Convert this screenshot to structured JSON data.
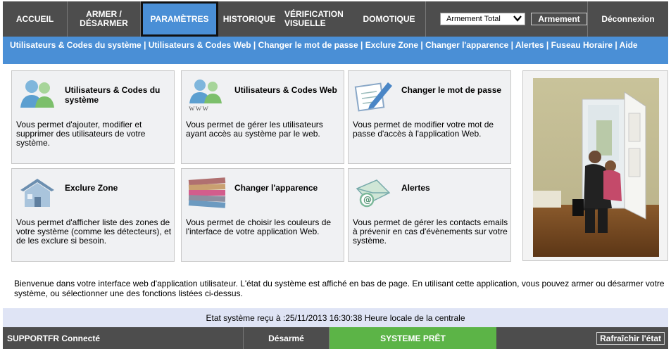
{
  "nav": {
    "accueil": "ACCUEIL",
    "armer_line1": "ARMER /",
    "armer_line2": "DÉSARMER",
    "parametres": "PARAMÈTRES",
    "historique": "HISTORIQUE",
    "verif_line1": "VÉRIFICATION",
    "verif_line2": "VISUELLE",
    "domotique": "DOMOTIQUE",
    "arm_select_value": "Armement Total",
    "arm_button": "Armement",
    "deconnexion": "Déconnexion"
  },
  "subnav": {
    "links": [
      "Utilisateurs & Codes du système",
      "Utilisateurs & Codes Web",
      "Changer le mot de passe",
      "Exclure Zone",
      "Changer l'apparence",
      "Alertes",
      "Fuseau Horaire",
      "Aide"
    ]
  },
  "tiles": [
    {
      "title": "Utilisateurs & Codes du système",
      "desc": "Vous permet d'ajouter, modifier et supprimer des utilisateurs de votre système.",
      "icon": "users-icon"
    },
    {
      "title": "Utilisateurs & Codes Web",
      "desc": "Vous permet de gérer les utilisateurs ayant accès au système par le web.",
      "icon": "web-users-icon",
      "icon_text": "www"
    },
    {
      "title": "Changer le mot de passe",
      "desc": "Vous permet de modifier votre mot de passe d'accès à l'application Web.",
      "icon": "pen-icon"
    },
    {
      "title": "Exclure Zone",
      "desc": "Vous permet d'afficher liste des zones de votre système (comme les détecteurs), et de les exclure si besoin.",
      "icon": "house-icon"
    },
    {
      "title": "Changer l'apparence",
      "desc": "Vous permet de choisir les couleurs de l'interface de votre application Web.",
      "icon": "palette-icon"
    },
    {
      "title": "Alertes",
      "desc": "Vous permet de gérer les contacts emails à prévenir en cas d'évènements sur votre système.",
      "icon": "email-icon"
    }
  ],
  "welcome": "Bienvenue dans votre interface web d'application utilisateur. L'état du système est affiché en bas de page. En utilisant cette application, vous pouvez armer ou désarmer votre système, ou sélectionner une des fonctions listées ci-dessus.",
  "status_line": "Etat système reçu à :25/11/2013 16:30:38 Heure locale de la centrale",
  "footer": {
    "user": "SUPPORTFR Connecté",
    "state": "Désarmé",
    "ready": "SYSTEME PRÊT",
    "refresh": "Rafraîchir l'état"
  },
  "colors": {
    "nav_bg": "#4d4d4d",
    "accent_blue": "#4a8fd6",
    "ready_green": "#5cb447",
    "status_bg": "#dfe4f5"
  }
}
